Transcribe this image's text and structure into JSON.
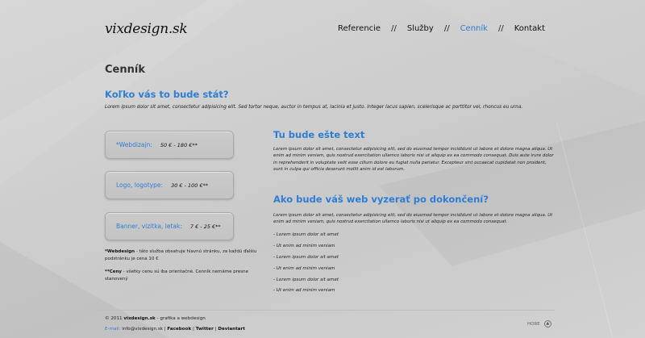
{
  "logo": {
    "text": "vixdesign.sk"
  },
  "nav": {
    "items": [
      {
        "label": "Referencie"
      },
      {
        "label": "Služby"
      },
      {
        "label": "Cenník"
      },
      {
        "label": "Kontakt"
      }
    ],
    "separator": "//",
    "active_index": 2
  },
  "page_title": "Cenník",
  "question_title": "Koľko vás to bude stát?",
  "intro_text": "Lorem ipsum dolor sit amet, consectetur adipisicing elit. Sed tortor neque, auctor in tempus at, lacinia et justo. Integer lacus sapien, scelerisque ac porttitor vel, rhoncus eu urna.",
  "price_boxes": [
    {
      "label": "*Webdizajn:",
      "price": "50 € - 180 €**"
    },
    {
      "label": "Logo, logotype:",
      "price": "30 € - 100 €**"
    },
    {
      "label": "Banner, vizitka, letak:",
      "price": "7 € - 25 €**"
    }
  ],
  "notes": {
    "webdesign_bold": "*Webdesign",
    "webdesign_text": " - táto služba obsahuje hlavnú stránku, za každú ďalšiu podstránku je cena 10 €",
    "ceny_bold": "**Ceny",
    "ceny_text": " - všetky cenu sú iba orientačné. Cenník nemáme presne stanovený"
  },
  "section1": {
    "title": "Tu bude ešte text",
    "text": "Lorem ipsum dolor sit amet, consectetur adipisicing elit, sed do eiusmod tempor incididunt ut labore et dolore magna aliqua. Ut enim ad minim veniam, quis nostrud exercitation ullamco laboris nisi ut aliquip ex ea commodo consequat. Duis aute irure dolor in reprehenderit in voluptate velit esse cillum dolore eu fugiat nulla pariatur. Excepteur sint occaecat cupidatat non proident, sunt in culpa qui officia deserunt mollit anim id est laborum."
  },
  "section2": {
    "title": "Ako bude váš web vyzerať po dokončení?",
    "text": "Lorem ipsum dolor sit amet, consectetur adipisicing elit, sed do eiusmod tempor incididunt ut labore et dolore magna aliqua. Ut enim ad minim veniam, quis nostrud exercitation ullamco laboris nisi ut aliquip ex ea commodo consequat.",
    "list": [
      "- Lorem ipsum dolor sit amet",
      "- Ut enim ad minim veniam",
      "- Lorem ipsum dolor sit amet",
      "- Ut enim ad minim veniam",
      "- Lorem ipsum dolor sit amet",
      "- Ut enim ad minim veniam"
    ]
  },
  "footer": {
    "copyright_prefix": "© 2011 ",
    "copyright_site": "vixdesign.sk",
    "copyright_suffix": " - grafika a webdesign",
    "email_label": "E-mail:",
    "email": "info@vixdesign.sk",
    "links": [
      "Facebook",
      "Twitter",
      "Deviantart"
    ],
    "link_separator": " | ",
    "back_to_top": "HORE",
    "up_icon": "up-arrow-circle-icon"
  },
  "colors": {
    "accent": "#2e7ed6",
    "background": "#d0d0d0"
  }
}
